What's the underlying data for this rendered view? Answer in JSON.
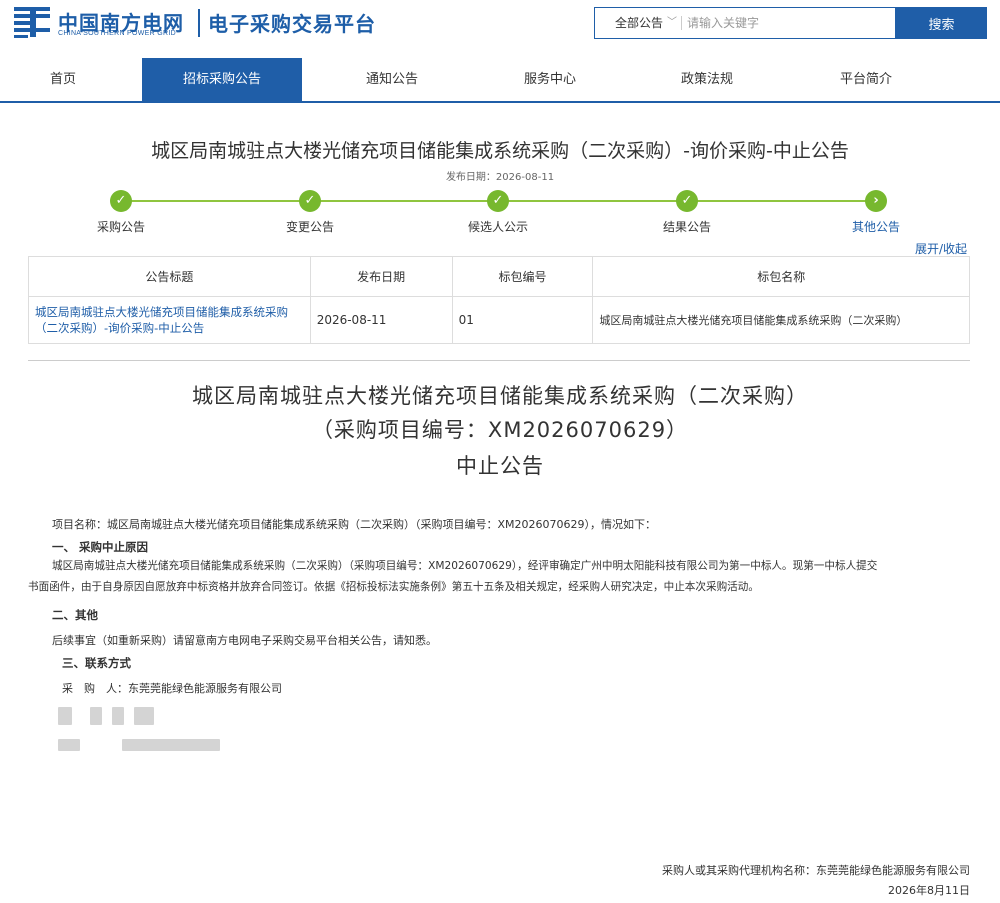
{
  "header": {
    "brand_cn": "中国南方电网",
    "brand_en": "CHINA SOUTHERN POWER GRID",
    "platform_title": "电子采购交易平台",
    "search_scope": "全部公告",
    "search_placeholder": "请输入关键字",
    "search_button": "搜索"
  },
  "nav": {
    "items": [
      {
        "label": "首页"
      },
      {
        "label": "招标采购公告"
      },
      {
        "label": "通知公告"
      },
      {
        "label": "服务中心"
      },
      {
        "label": "政策法规"
      },
      {
        "label": "平台简介"
      }
    ],
    "active_index": 1
  },
  "notice": {
    "title": "城区局南城驻点大楼光储充项目储能集成系统采购（二次采购）-询价采购-中止公告",
    "publish_date": "发布日期：2026-08-11",
    "steps": [
      {
        "label": "采购公告",
        "icon": "check-icon"
      },
      {
        "label": "变更公告",
        "icon": "check-icon"
      },
      {
        "label": "候选人公示",
        "icon": "check-icon"
      },
      {
        "label": "结果公告",
        "icon": "check-icon"
      },
      {
        "label": "其他公告",
        "icon": "chevron-right-icon"
      }
    ],
    "toggle": "展开/收起"
  },
  "table": {
    "headers": [
      "公告标题",
      "发布日期",
      "标包编号",
      "标包名称"
    ],
    "rows": [
      {
        "title": "城区局南城驻点大楼光储充项目储能集成系统采购（二次采购）-询价采购-中止公告",
        "date": "2026-08-11",
        "lot_no": "01",
        "lot_name": "城区局南城驻点大楼光储充项目储能集成系统采购（二次采购）"
      }
    ]
  },
  "document": {
    "heading_1": "城区局南城驻点大楼光储充项目储能集成系统采购（二次采购）",
    "heading_2": "（采购项目编号：XM2026070629）",
    "heading_3": "中止公告",
    "intro": "项目名称：城区局南城驻点大楼光储充项目储能集成系统采购（二次采购）（采购项目编号：XM2026070629），情况如下：",
    "sec1_title": "一、 采购中止原因",
    "sec1_line1": "城区局南城驻点大楼光储充项目储能集成系统采购（二次采购）（采购项目编号：XM2026070629），经评审确定广州中明太阳能科技有限公司为第一中标人。现第一中标人提交",
    "sec1_line2": "书面函件，由于自身原因自愿放弃中标资格并放弃合同签订。依据《招标投标法实施条例》第五十五条及相关规定，经采购人研究决定，中止本次采购活动。",
    "sec2_title": "二、其他",
    "sec2_body": "后续事宜（如重新采购）请留意南方电网电子采购交易平台相关公告，请知悉。",
    "sec3_title": "三、联系方式",
    "purchaser": "采　购　人：东莞莞能绿色能源服务有限公司",
    "footer_org": "采购人或其采购代理机构名称：东莞莞能绿色能源服务有限公司",
    "footer_date": "2026年8月11日"
  },
  "colors": {
    "brand": "#1f5ea8",
    "step_done": "#77b82e"
  }
}
